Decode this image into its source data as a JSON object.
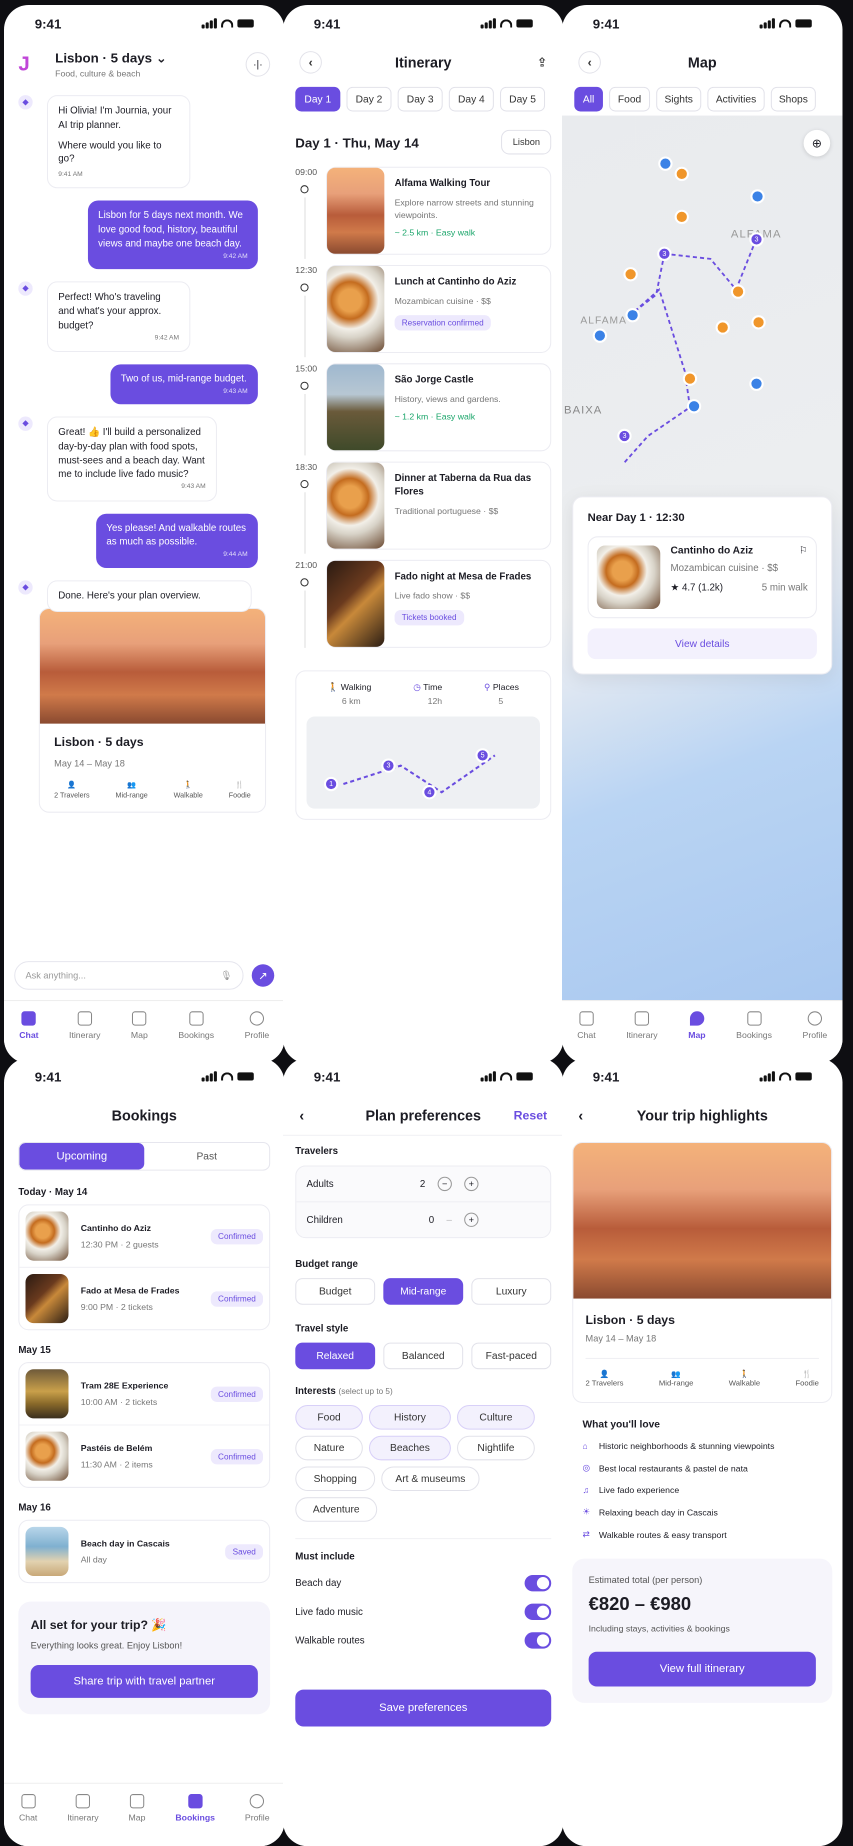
{
  "status": {
    "time": "9:41"
  },
  "chat": {
    "trip_title": "Lisbon · 5 days",
    "trip_sub": "Food, culture & beach",
    "messages": [
      {
        "from": "ai",
        "text": "Hi Olivia! I'm Journia, your AI trip planner.",
        "text2": "Where would you like to go?",
        "time": "9:41 AM"
      },
      {
        "from": "user",
        "text": "Lisbon for 5 days next month. We love good food, history, beautiful views and maybe one beach day.",
        "time": "9:42 AM"
      },
      {
        "from": "ai",
        "text": "Perfect! Who's traveling and what's your approx. budget?",
        "time": "9:42 AM"
      },
      {
        "from": "user",
        "text": "Two of us, mid-range budget.",
        "time": "9:43 AM"
      },
      {
        "from": "ai",
        "text": "Great! 👍 I'll build a personalized day-by-day plan with food spots, must-sees and a beach day. Want me to include live fado music?",
        "time": "9:43 AM"
      },
      {
        "from": "user",
        "text": "Yes please! And walkable routes as much as possible.",
        "time": "9:44 AM"
      },
      {
        "from": "ai",
        "text": "Done. Here's your plan overview."
      }
    ],
    "plan_card": {
      "title": "Lisbon · 5 days",
      "dates": "May 14 – May 18",
      "tags": [
        "2 Travelers",
        "Mid-range",
        "Walkable",
        "Foodie"
      ]
    },
    "input_placeholder": "Ask anything..."
  },
  "tabs": [
    "Chat",
    "Itinerary",
    "Map",
    "Bookings",
    "Profile"
  ],
  "itinerary": {
    "title": "Itinerary",
    "days": [
      "Day 1",
      "Day 2",
      "Day 3",
      "Day 4",
      "Day 5"
    ],
    "day_heading": "Day 1 · Thu, May 14",
    "city_chip": "Lisbon",
    "items": [
      {
        "time": "09:00",
        "title": "Alfama Walking Tour",
        "desc": "Explore narrow streets and stunning viewpoints.",
        "meta": "~ 2.5 km · Easy walk",
        "img": "city"
      },
      {
        "time": "12:30",
        "title": "Lunch at Cantinho do Aziz",
        "desc": "Mozambican cuisine · $$",
        "meta": "Reservation confirmed",
        "img": "food"
      },
      {
        "time": "15:00",
        "title": "São Jorge Castle",
        "desc": "History, views and gardens.",
        "meta": "~ 1.2 km · Easy walk",
        "img": "castle"
      },
      {
        "time": "18:30",
        "title": "Dinner at Taberna da Rua das Flores",
        "desc": "Traditional portuguese · $$",
        "meta": "",
        "img": "food"
      },
      {
        "time": "21:00",
        "title": "Fado night at Mesa de Frades",
        "desc": "Live fado show · $$",
        "meta": "Tickets booked",
        "img": "fado"
      }
    ],
    "stats": [
      {
        "label": "Walking",
        "value": "6 km"
      },
      {
        "label": "Time",
        "value": "12h"
      },
      {
        "label": "Places",
        "value": "5"
      }
    ]
  },
  "map": {
    "title": "Map",
    "filters": [
      "All",
      "Food",
      "Sights",
      "Activities",
      "Shops"
    ],
    "labels": [
      "ALFAMA",
      "ALFAMA",
      "BAIXA"
    ],
    "near": "Near Day 1 · 12:30",
    "place": {
      "name": "Cantinho do Aziz",
      "cuisine": "Mozambican cuisine · $$",
      "rating": "4.7 (1.2k)",
      "walk": "5 min walk"
    },
    "view_details": "View details"
  },
  "bookings": {
    "title": "Bookings",
    "segments": [
      "Upcoming",
      "Past"
    ],
    "groups": [
      {
        "date": "Today · May 14",
        "items": [
          {
            "name": "Cantinho do Aziz",
            "sub": "12:30 PM · 2 guests",
            "status": "Confirmed",
            "img": "food"
          },
          {
            "name": "Fado at Mesa de Frades",
            "sub": "9:00 PM · 2 tickets",
            "status": "Confirmed",
            "img": "fado"
          }
        ]
      },
      {
        "date": "May 15",
        "items": [
          {
            "name": "Tram 28E Experience",
            "sub": "10:00 AM · 2 tickets",
            "status": "Confirmed",
            "img": "tram"
          },
          {
            "name": "Pastéis de Belém",
            "sub": "11:30 AM · 2 items",
            "status": "Confirmed",
            "img": "food"
          }
        ]
      },
      {
        "date": "May 16",
        "items": [
          {
            "name": "Beach day in Cascais",
            "sub": "All day",
            "status": "Saved",
            "img": "beach"
          }
        ]
      }
    ],
    "allset_title": "All set for your trip? 🎉",
    "allset_sub": "Everything looks great. Enjoy Lisbon!",
    "share_button": "Share trip with travel partner"
  },
  "prefs": {
    "title": "Plan preferences",
    "reset": "Reset",
    "travelers_label": "Travelers",
    "adults_label": "Adults",
    "adults": "2",
    "children_label": "Children",
    "children": "0",
    "budget_label": "Budget range",
    "budget": [
      "Budget",
      "Mid-range",
      "Luxury"
    ],
    "style_label": "Travel style",
    "style": [
      "Relaxed",
      "Balanced",
      "Fast-paced"
    ],
    "interests_label": "Interests",
    "interests_hint": "(select up to 5)",
    "interests": [
      "Food",
      "History",
      "Culture",
      "Nature",
      "Beaches",
      "Nightlife",
      "Shopping",
      "Art & museums",
      "Adventure"
    ],
    "must_label": "Must include",
    "must": [
      "Beach day",
      "Live fado music",
      "Walkable routes"
    ],
    "save": "Save preferences"
  },
  "highlights": {
    "title": "Your trip highlights",
    "trip": "Lisbon · 5 days",
    "dates": "May 14 – May 18",
    "tags": [
      "2 Travelers",
      "Mid-range",
      "Walkable",
      "Foodie"
    ],
    "love_label": "What you'll love",
    "love": [
      "Historic neighborhoods & stunning viewpoints",
      "Best local restaurants & pastel de nata",
      "Live fado experience",
      "Relaxing beach day in Cascais",
      "Walkable routes & easy transport"
    ],
    "est_label": "Estimated total (per person)",
    "est_value": "€820 – €980",
    "est_sub": "Including stays, activities & bookings",
    "cta": "View full itinerary"
  }
}
